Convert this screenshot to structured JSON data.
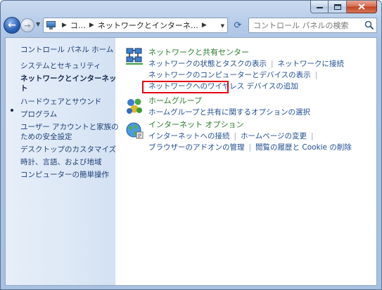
{
  "address": {
    "crumb1": "コ…",
    "crumb2": "ネットワークとインターネ…"
  },
  "search": {
    "placeholder": "コントロール パネルの検索"
  },
  "sidebar": {
    "home": "コントロール パネル ホーム",
    "items": [
      "システムとセキュリティ",
      "ネットワークとインターネット",
      "ハードウェアとサウンド",
      "プログラム",
      "ユーザー アカウントと家族のための安全設定",
      "デスクトップのカスタマイズ",
      "時計、言語、および地域",
      "コンピューターの簡単操作"
    ],
    "current_line1": "ネットワークとインターネッ",
    "current_line2": "ト",
    "user_line1": "ユーザー アカウントと家族の",
    "user_line2": "ための安全設定"
  },
  "categories": [
    {
      "title": "ネットワークと共有センター",
      "tasks": [
        [
          "ネットワークの状態とタスクの表示",
          "ネットワークに接続"
        ],
        [
          "ネットワークのコンピューターとデバイスの表示"
        ],
        [
          "ネットワークへのワイヤレス デバイスの追加"
        ]
      ]
    },
    {
      "title": "ホームグループ",
      "tasks": [
        [
          "ホームグループと共有に関するオプションの選択"
        ]
      ]
    },
    {
      "title": "インターネット オプション",
      "tasks": [
        [
          "インターネットへの接続",
          "ホームページの変更"
        ],
        [
          "ブラウザーのアドオンの管理",
          "閲覧の履歴と Cookie の削除"
        ]
      ]
    }
  ],
  "colors": {
    "link": "#1e4b93",
    "category_title": "#2a7d2a",
    "highlight": "#e60012"
  }
}
